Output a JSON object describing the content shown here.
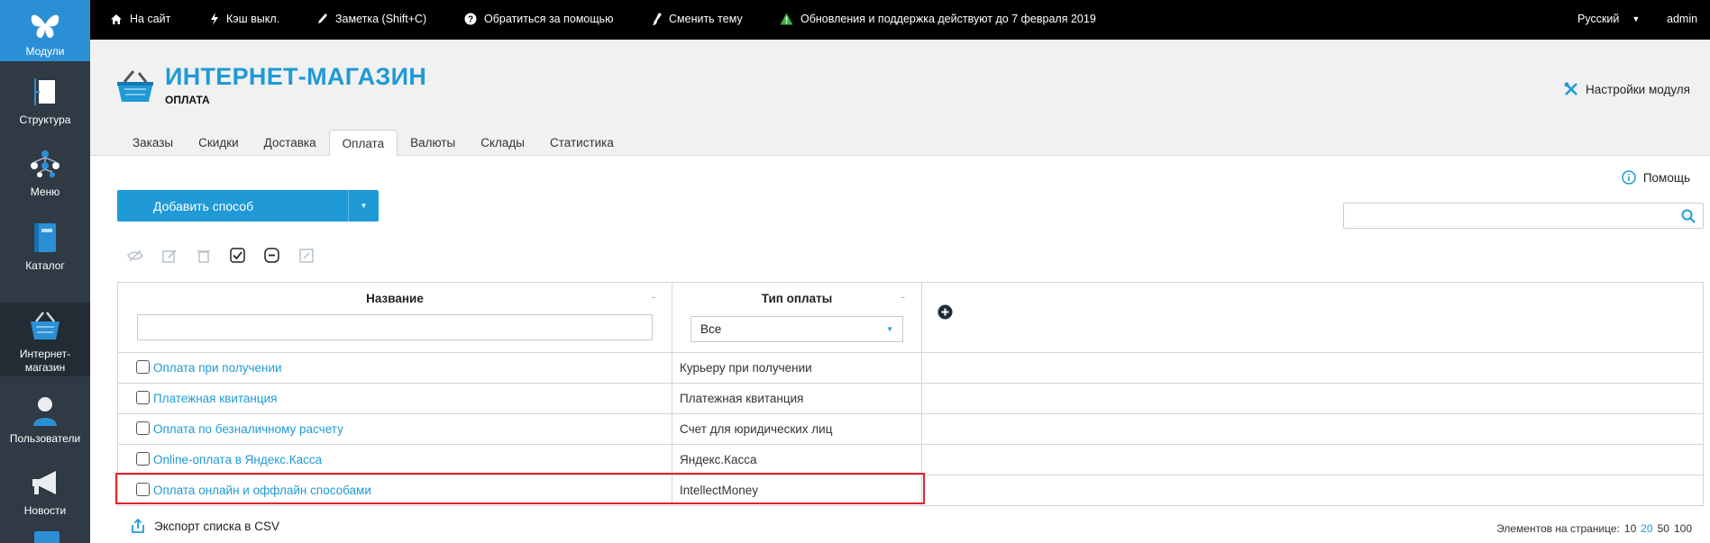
{
  "sidebar": {
    "items": [
      {
        "label": "Модули",
        "icon": "butterfly-icon"
      },
      {
        "label": "Структура",
        "icon": "structure-icon"
      },
      {
        "label": "Меню",
        "icon": "menu-tree-icon"
      },
      {
        "label": "Каталог",
        "icon": "catalog-book-icon"
      },
      {
        "label": "Интернет-магазин",
        "label_line1": "Интернет-",
        "label_line2": "магазин",
        "icon": "basket-icon"
      },
      {
        "label": "Пользователи",
        "icon": "user-icon"
      },
      {
        "label": "Новости",
        "icon": "megaphone-icon"
      }
    ]
  },
  "topbar": {
    "site": "На сайт",
    "cache": "Кэш выкл.",
    "note": "Заметка (Shift+C)",
    "help": "Обратиться за помощью",
    "theme": "Сменить тему",
    "updates": "Обновления и поддержка действуют до 7 февраля 2019",
    "language": "Русский",
    "user": "admin"
  },
  "header": {
    "title": "ИНТЕРНЕТ-МАГАЗИН",
    "subtitle": "ОПЛАТА",
    "settings": "Настройки модуля"
  },
  "tabs": [
    "Заказы",
    "Скидки",
    "Доставка",
    "Оплата",
    "Валюты",
    "Склады",
    "Статистика"
  ],
  "active_tab": "Оплата",
  "toolbar": {
    "help": "Помощь",
    "add_button": "Добавить способ",
    "search_value": ""
  },
  "table": {
    "columns": [
      "Название",
      "Тип оплаты"
    ],
    "filter_select": "Все",
    "rows": [
      {
        "name": "Оплата при получении",
        "type": "Курьеру при получении"
      },
      {
        "name": "Платежная квитанция",
        "type": "Платежная квитанция"
      },
      {
        "name": "Оплата по безналичному расчету",
        "type": "Счет для юридических лиц"
      },
      {
        "name": "Online-оплата в Яндекс.Касса",
        "type": "Яндекс.Касса"
      },
      {
        "name": "Оплата онлайн и оффлайн способами",
        "type": "IntellectMoney"
      }
    ]
  },
  "footer": {
    "export": "Экспорт списка в CSV",
    "per_page_label": "Элементов на странице:",
    "per_page_options": [
      "10",
      "20",
      "50",
      "100"
    ],
    "per_page_current": "20"
  },
  "colors": {
    "accent": "#1f9ad6",
    "sidebar": "#2f3a45",
    "highlight": "#e0252b",
    "warning": "#3cb043"
  }
}
